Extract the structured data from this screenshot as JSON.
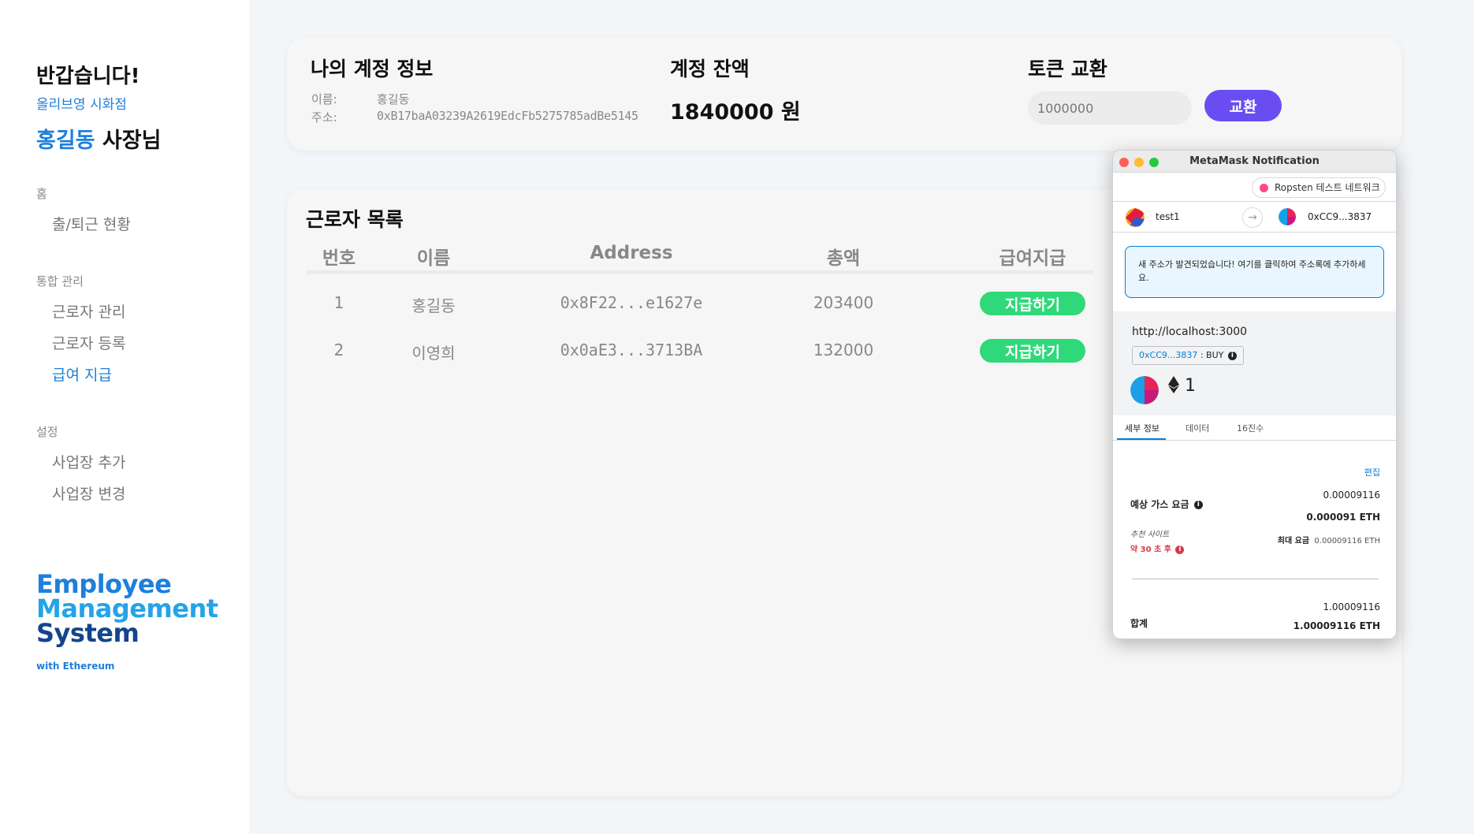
{
  "sidebar": {
    "greeting": "반갑습니다!",
    "store_name": "올리브영 시화점",
    "owner_name": "홍길동",
    "owner_suffix": " 사장님",
    "sections": [
      {
        "title": "홈",
        "items": [
          "출/퇴근 현황"
        ]
      },
      {
        "title": "통합 관리",
        "items": [
          "근로자 관리",
          "근로자 등록",
          "급여 지급"
        ]
      },
      {
        "title": "설정",
        "items": [
          "사업장 추가",
          "사업장 변경"
        ]
      }
    ],
    "active_item": "급여 지급",
    "logo": {
      "line1": "Employee",
      "line2": "Management",
      "line3": "System",
      "sub": "with Ethereum"
    }
  },
  "account": {
    "title": "나의 계정 정보",
    "name_label": "이름:",
    "name_value": "홍길동",
    "address_label": "주소:",
    "address_value": "0xB17baA03239A2619EdcFb5275785adBe5145",
    "balance_title": "계정 잔액",
    "balance_value": "1840000 원",
    "swap_title": "토큰 교환",
    "swap_placeholder": "1000000",
    "swap_button": "교환"
  },
  "workers": {
    "title": "근로자 목록",
    "columns": [
      "번호",
      "이름",
      "Address",
      "총액",
      "급여지급"
    ],
    "rows": [
      {
        "no": "1",
        "name": "홍길동",
        "address": "0x8F22...e1627e",
        "total": "203400",
        "action": "지급하기"
      },
      {
        "no": "2",
        "name": "이영희",
        "address": "0x0aE3...3713BA",
        "total": "132000",
        "action": "지급하기"
      }
    ]
  },
  "metamask": {
    "window_title": "MetaMask Notification",
    "network": "Ropsten 테스트 네트워크",
    "from_account": "test1",
    "to_account": "0xCC9...3837",
    "notice": "새 주소가 발견되었습니다! 여기를 클릭하여 주소록에 추가하세요.",
    "origin": "http://localhost:3000",
    "method_address": "0xCC9...3837",
    "method_name": " : BUY",
    "amount": "1",
    "tabs": [
      "세부 정보",
      "데이터",
      "16진수"
    ],
    "edit": "편집",
    "gas_label": "예상 가스 요금",
    "gas_value": "0.00009116",
    "gas_eth": "0.000091 ETH",
    "site_label": "추천 사이트",
    "time_label": "약 30 초 후",
    "max_fee_label": "최대 요금",
    "max_fee_value": "0.00009116 ETH",
    "total_label": "합계",
    "total_value": "1.00009116",
    "total_eth": "1.00009116 ETH"
  }
}
